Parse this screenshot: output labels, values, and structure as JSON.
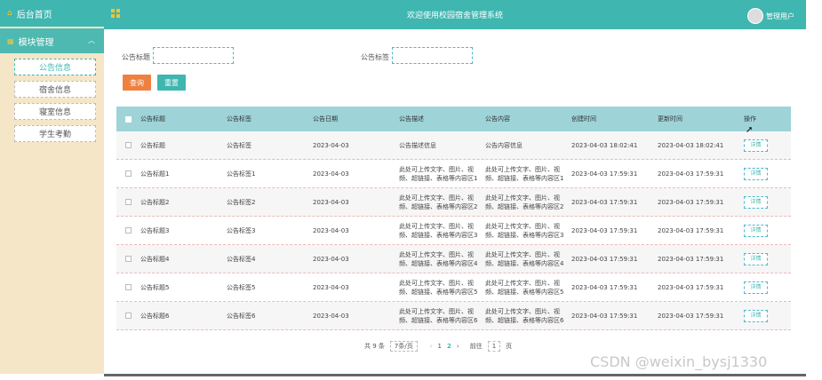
{
  "sidebar": {
    "home": "后台首页",
    "group": "模块管理",
    "items": [
      "公告信息",
      "宿舍信息",
      "寝室信息",
      "学生考勤"
    ]
  },
  "topbar": {
    "title": "欢迎使用校园宿舍管理系统",
    "user": "管理用户"
  },
  "filters": {
    "label1": "公告标题",
    "label2": "公告标签",
    "query": "查询",
    "reset": "重置"
  },
  "table": {
    "headers": [
      "公告标题",
      "公告标签",
      "公告日期",
      "公告描述",
      "公告内容",
      "创建时间",
      "更新时间",
      "操作"
    ],
    "rows": [
      [
        "公告标题",
        "公告标签",
        "2023-04-03",
        "公告描述信息",
        "公告内容信息",
        "2023-04-03 18:02:41",
        "2023-04-03 18:02:41",
        "详情"
      ],
      [
        "公告标题1",
        "公告标签1",
        "2023-04-03",
        "此处可上传文字、图片、视频、超链接、表格等内容区1",
        "此处可上传文字、图片、视频、超链接、表格等内容区1",
        "2023-04-03 17:59:31",
        "2023-04-03 17:59:31",
        "详情"
      ],
      [
        "公告标题2",
        "公告标签2",
        "2023-04-03",
        "此处可上传文字、图片、视频、超链接、表格等内容区2",
        "此处可上传文字、图片、视频、超链接、表格等内容区2",
        "2023-04-03 17:59:31",
        "2023-04-03 17:59:31",
        "详情"
      ],
      [
        "公告标题3",
        "公告标签3",
        "2023-04-03",
        "此处可上传文字、图片、视频、超链接、表格等内容区3",
        "此处可上传文字、图片、视频、超链接、表格等内容区3",
        "2023-04-03 17:59:31",
        "2023-04-03 17:59:31",
        "详情"
      ],
      [
        "公告标题4",
        "公告标签4",
        "2023-04-03",
        "此处可上传文字、图片、视频、超链接、表格等内容区4",
        "此处可上传文字、图片、视频、超链接、表格等内容区4",
        "2023-04-03 17:59:31",
        "2023-04-03 17:59:31",
        "详情"
      ],
      [
        "公告标题5",
        "公告标签5",
        "2023-04-03",
        "此处可上传文字、图片、视频、超链接、表格等内容区5",
        "此处可上传文字、图片、视频、超链接、表格等内容区5",
        "2023-04-03 17:59:31",
        "2023-04-03 17:59:31",
        "详情"
      ],
      [
        "公告标题6",
        "公告标签6",
        "2023-04-03",
        "此处可上传文字、图片、视频、超链接、表格等内容区6",
        "此处可上传文字、图片、视频、超链接、表格等内容区6",
        "2023-04-03 17:59:31",
        "2023-04-03 17:59:31",
        "详情"
      ]
    ]
  },
  "pager": {
    "total": "共 9 条",
    "page_size": "7条/页",
    "prev": "‹",
    "pages": [
      "1",
      "2"
    ],
    "next": "›",
    "goto_label": "前往",
    "goto_value": "1",
    "goto_suffix": "页"
  },
  "watermark": "CSDN @weixin_bysj1330"
}
